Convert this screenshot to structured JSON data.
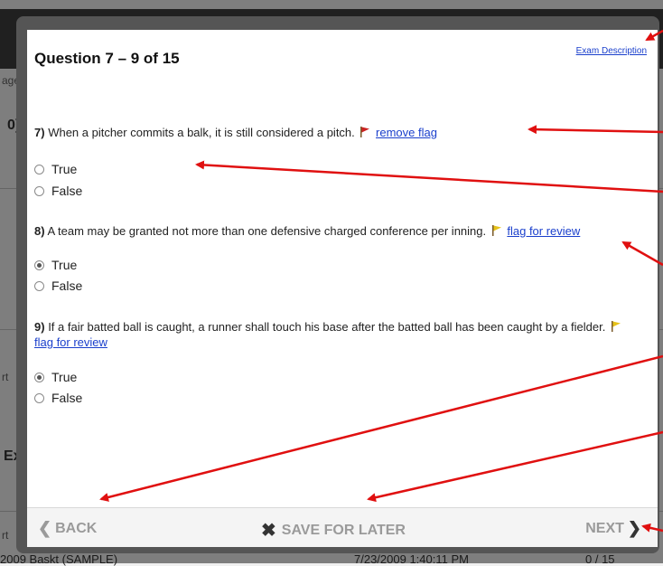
{
  "background": {
    "fragments": [
      {
        "text": "age",
        "id": "frag-age"
      },
      {
        "text": "0)",
        "id": "frag-0"
      },
      {
        "text": "rt",
        "id": "frag-rt1"
      },
      {
        "text": "Ex",
        "id": "frag-ex"
      },
      {
        "text": "rt",
        "id": "frag-rt2"
      }
    ],
    "footer_left": "2009 Baskt (SAMPLE)",
    "footer_mid": "7/23/2009 1:40:11 PM",
    "footer_right": "0 / 15"
  },
  "modal": {
    "title": "Question 7 – 9 of 15",
    "exam_description_link": "Exam Description",
    "questions": [
      {
        "number": "7)",
        "text": "When a pitcher commits a balk, it is still considered a pitch.",
        "flag_color": "#cc2222",
        "flag_label": "remove flag",
        "options": [
          {
            "label": "True",
            "checked": false
          },
          {
            "label": "False",
            "checked": false
          }
        ]
      },
      {
        "number": "8)",
        "text": "A team may be granted not more than one defensive charged conference per inning.",
        "flag_color": "#e6c21a",
        "flag_label": "flag for review",
        "options": [
          {
            "label": "True",
            "checked": true
          },
          {
            "label": "False",
            "checked": false
          }
        ]
      },
      {
        "number": "9)",
        "text": "If a fair batted ball is caught, a runner shall touch his base after the batted ball has been caught by a fielder.",
        "flag_color": "#e6c21a",
        "flag_label": "flag for review",
        "options": [
          {
            "label": "True",
            "checked": true
          },
          {
            "label": "False",
            "checked": false
          }
        ]
      }
    ],
    "footer": {
      "back_label": "BACK",
      "save_label": "SAVE FOR LATER",
      "next_label": "NEXT"
    }
  },
  "colors": {
    "annotation_arrow": "#e01010",
    "link": "#1a3fcc"
  }
}
